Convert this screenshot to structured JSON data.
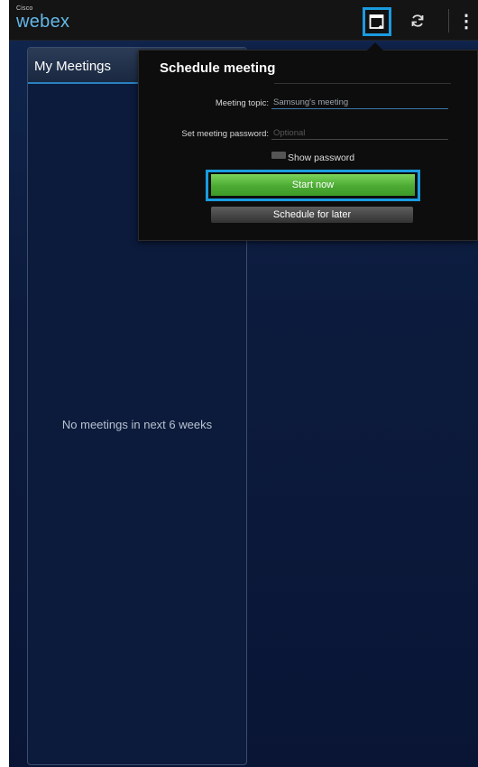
{
  "topbar": {
    "logo_small": "Cisco",
    "logo_main": "webex",
    "icons": {
      "new_meeting": "new-meeting-icon",
      "refresh": "refresh-icon",
      "overflow": "overflow-menu-icon"
    },
    "overflow_glyph": "⋮",
    "refresh_glyph": "↻"
  },
  "meetings_panel": {
    "title": "My Meetings",
    "empty_message": "No meetings in next 6 weeks"
  },
  "schedule_popup": {
    "title": "Schedule meeting",
    "topic_label": "Meeting topic:",
    "topic_value": "Samsung's meeting",
    "password_label": "Set meeting password:",
    "password_placeholder": "Optional",
    "show_password_label": "Show password",
    "start_now_label": "Start now",
    "schedule_later_label": "Schedule for later"
  },
  "colors": {
    "accent_highlight": "#1a9be0",
    "start_button": "#4caa34",
    "background": "#0c1a38",
    "logo": "#63b7e8"
  }
}
